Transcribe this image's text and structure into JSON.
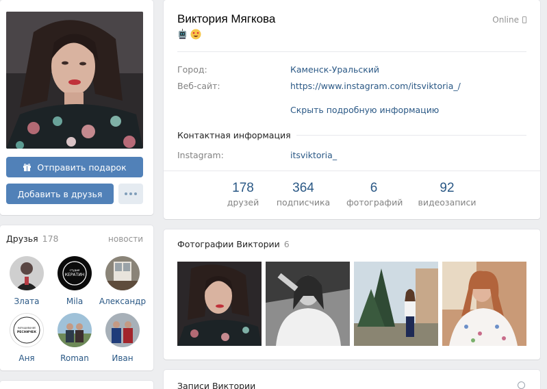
{
  "profile": {
    "name": "Виктория Мягкова",
    "online": "Online",
    "gift_button": "Отправить подарок",
    "add_friend_button": "Добавить в друзья"
  },
  "info": {
    "city_label": "Город:",
    "city_value": "Каменск-Уральский",
    "site_label": "Веб-сайт:",
    "site_value": "https://www.instagram.com/itsviktoria_/",
    "hide_link": "Скрыть подробную информацию",
    "contact_header": "Контактная информация",
    "instagram_label": "Instagram:",
    "instagram_value": "itsviktoria_"
  },
  "counters": [
    {
      "num": "178",
      "label": "друзей"
    },
    {
      "num": "364",
      "label": "подписчика"
    },
    {
      "num": "6",
      "label": "фотографий"
    },
    {
      "num": "92",
      "label": "видеозаписи"
    }
  ],
  "friends": {
    "title": "Друзья",
    "count": "178",
    "news": "новости",
    "items": [
      {
        "name": "Злата"
      },
      {
        "name": "Mila"
      },
      {
        "name": "Александр"
      },
      {
        "name": "Аня"
      },
      {
        "name": "Roman"
      },
      {
        "name": "Иван"
      }
    ],
    "avatar_text": {
      "mila": [
        "студия",
        "КЕРАТИН"
      ],
      "anya": [
        "НАРАЩИВАНИЕ",
        "РЕСНИЧЕК"
      ]
    }
  },
  "photos": {
    "title": "Фотографии Виктории",
    "count": "6"
  },
  "wall": {
    "title": "Записи Виктории"
  },
  "colors": {
    "accent": "#5181b8",
    "link": "#2a5885",
    "background": "#edeef0"
  }
}
